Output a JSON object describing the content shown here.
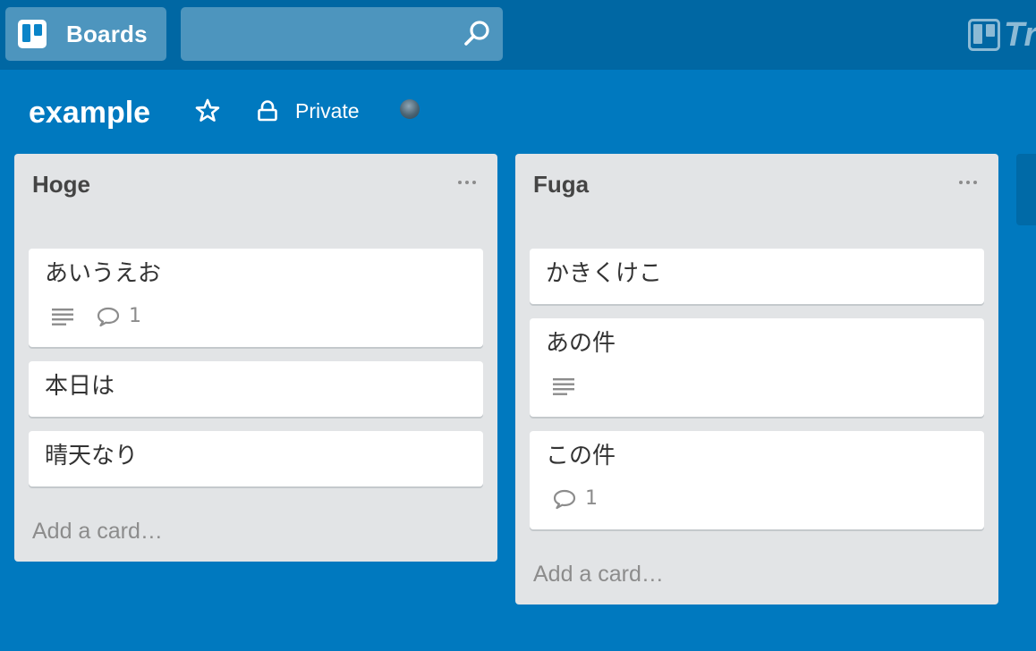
{
  "header": {
    "boards_label": "Boards",
    "search_value": "",
    "logo_text": "Tr"
  },
  "board": {
    "title": "example",
    "privacy_label": "Private"
  },
  "lists": [
    {
      "title": "Hoge",
      "cards": [
        {
          "title": "あいうえお",
          "comment_count": "1"
        },
        {
          "title": "本日は"
        },
        {
          "title": "晴天なり"
        }
      ],
      "add_card_label": "Add a card…"
    },
    {
      "title": "Fuga",
      "cards": [
        {
          "title": "かきくけこ"
        },
        {
          "title": "あの件"
        },
        {
          "title": "この件",
          "comment_count": "1"
        }
      ],
      "add_card_label": "Add a card…"
    }
  ],
  "colors": {
    "board_bg": "#0079bf",
    "header_bg": "#0067a3",
    "list_bg": "#e2e4e6",
    "card_bg": "#ffffff",
    "muted_text": "#8c8c8c"
  },
  "icons": {
    "boards": "trello-boards-icon",
    "search": "search-icon",
    "star": "star-icon",
    "privacy": "lock-icon",
    "list_menu": "more-horizontal-icon",
    "description": "description-icon",
    "comment": "comment-icon"
  }
}
